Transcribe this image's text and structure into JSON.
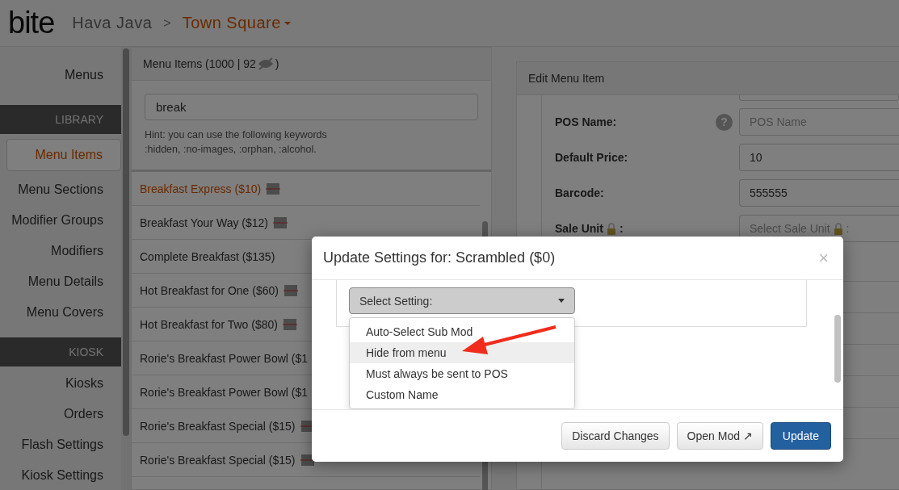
{
  "header": {
    "logo": "bite",
    "breadcrumb": [
      {
        "label": "Hava Java",
        "kind": "link"
      },
      {
        "label": ">",
        "kind": "separator"
      },
      {
        "label": "Town Square",
        "kind": "dropdown"
      }
    ]
  },
  "sidebar": {
    "top_items": [
      {
        "label": "Menus",
        "selected": false
      }
    ],
    "sections": [
      {
        "title": "LIBRARY",
        "items": [
          {
            "label": "Menu Items",
            "selected": true
          },
          {
            "label": "Menu Sections",
            "selected": false
          },
          {
            "label": "Modifier Groups",
            "selected": false
          },
          {
            "label": "Modifiers",
            "selected": false
          },
          {
            "label": "Menu Details",
            "selected": false
          },
          {
            "label": "Menu Covers",
            "selected": false
          }
        ]
      },
      {
        "title": "KIOSK",
        "items": [
          {
            "label": "Kiosks",
            "selected": false
          },
          {
            "label": "Orders",
            "selected": false
          },
          {
            "label": "Flash Settings",
            "selected": false
          },
          {
            "label": "Kiosk Settings",
            "selected": false
          }
        ]
      }
    ]
  },
  "menu_items": {
    "title": "Menu Items (1000 | 92",
    "title_end": ")",
    "search": {
      "value": "break"
    },
    "hint": "Hint: you can use the following keywords\n:hidden, :no-images, :orphan, :alcohol.",
    "rows": [
      {
        "label": "Breakfast Express ($10)",
        "barcode": true,
        "selected": true
      },
      {
        "label": "Breakfast Your Way ($12)",
        "barcode": true,
        "selected": false
      },
      {
        "label": "Complete Breakfast ($135)",
        "barcode": false,
        "selected": false
      },
      {
        "label": "Hot Breakfast for One ($60)",
        "barcode": true,
        "selected": false
      },
      {
        "label": "Hot Breakfast for Two ($80)",
        "barcode": true,
        "selected": false
      },
      {
        "label": "Rorie's Breakfast Power Bowl ($1",
        "barcode": false,
        "selected": false
      },
      {
        "label": "Rorie's Breakfast Power Bowl ($1",
        "barcode": false,
        "selected": false
      },
      {
        "label": "Rorie's Breakfast Special ($15)",
        "barcode": true,
        "selected": false
      },
      {
        "label": "Rorie's Breakfast Special ($15)",
        "barcode": true,
        "selected": false
      }
    ]
  },
  "edit_panel": {
    "title": "Edit Menu Item",
    "fields": [
      {
        "label": "POS Name:",
        "help": "?",
        "lock": false,
        "placeholder": "POS Name"
      },
      {
        "label": "Default Price:",
        "lock": false,
        "value": "10"
      },
      {
        "label": "Barcode:",
        "lock": false,
        "value": "555555"
      },
      {
        "label": "Sale Unit",
        "lock": true,
        "label_end": ":",
        "placeholder": "Select Sale Unit",
        "placeholder_end": ":"
      }
    ]
  },
  "modal": {
    "title": "Update Settings for: Scrambled ($0)",
    "close": "×",
    "select": {
      "label": "Select Setting:",
      "expanded": true
    },
    "options": [
      {
        "label": "Auto-Select Sub Mod",
        "selected": false
      },
      {
        "label": "Hide from menu",
        "selected": true
      },
      {
        "label": "Must always be sent to POS",
        "selected": false
      },
      {
        "label": "Custom Name",
        "selected": false
      }
    ],
    "buttons": [
      {
        "label": "Discard Changes",
        "kind": "default"
      },
      {
        "label": "Open Mod ↗",
        "kind": "default"
      },
      {
        "label": "Update",
        "kind": "primary"
      }
    ]
  }
}
